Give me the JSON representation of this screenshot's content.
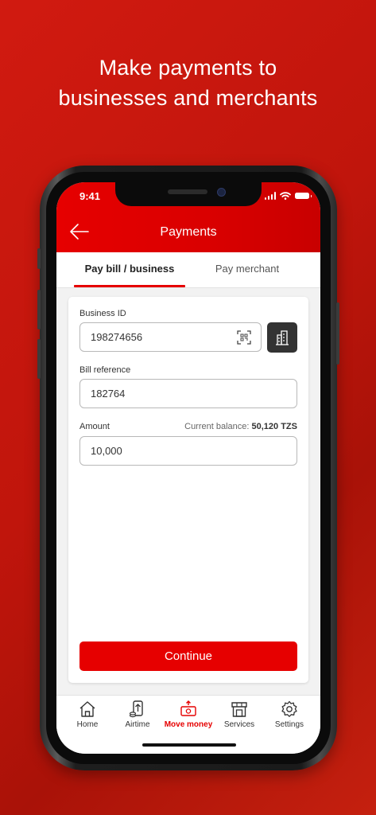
{
  "headline": {
    "line1": "Make payments to",
    "line2": "businesses and merchants"
  },
  "status_bar": {
    "time": "9:41"
  },
  "header": {
    "title": "Payments",
    "back_icon": "arrow-left-icon"
  },
  "tabs": [
    {
      "label": "Pay bill / business",
      "active": true
    },
    {
      "label": "Pay merchant",
      "active": false
    }
  ],
  "form": {
    "business_id": {
      "label": "Business ID",
      "value": "198274656",
      "icon": "qr-scan-icon"
    },
    "business_lookup_icon": "buildings-icon",
    "bill_reference": {
      "label": "Bill reference",
      "value": "182764"
    },
    "amount": {
      "label": "Amount",
      "value": "10,000",
      "balance_label": "Current balance:",
      "balance_value": "50,120 TZS"
    },
    "continue_label": "Continue"
  },
  "nav": [
    {
      "label": "Home",
      "icon": "home-icon",
      "active": false
    },
    {
      "label": "Airtime",
      "icon": "airtime-icon",
      "active": false
    },
    {
      "label": "Move money",
      "icon": "move-money-icon",
      "active": true
    },
    {
      "label": "Services",
      "icon": "services-icon",
      "active": false
    },
    {
      "label": "Settings",
      "icon": "settings-icon",
      "active": false
    }
  ],
  "colors": {
    "brand_red": "#e60000",
    "background_red": "#c0150c",
    "dark_button": "#333333"
  }
}
